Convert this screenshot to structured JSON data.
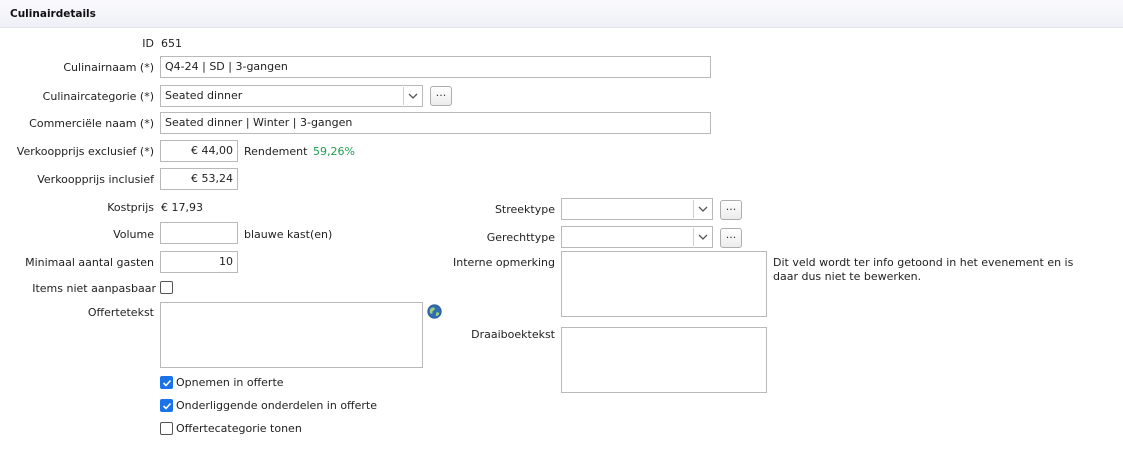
{
  "header": {
    "title": "Culinairdetails"
  },
  "fields": {
    "id": {
      "label": "ID",
      "value": "651"
    },
    "culinairnaam": {
      "label": "Culinairnaam (*)",
      "value": "Q4-24 | SD | 3-gangen"
    },
    "culinaircategorie": {
      "label": "Culinaircategorie (*)",
      "value": "Seated dinner",
      "more": "..."
    },
    "commerciele_naam": {
      "label": "Commerciële naam (*)",
      "value": "Seated dinner | Winter | 3-gangen"
    },
    "verkoopprijs_excl": {
      "label": "Verkoopprijs exclusief (*)",
      "value": "€ 44,00"
    },
    "rendement": {
      "label": "Rendement",
      "value": "59,26%"
    },
    "verkoopprijs_incl": {
      "label": "Verkoopprijs inclusief",
      "value": "€ 53,24"
    },
    "kostprijs": {
      "label": "Kostprijs",
      "value": "€ 17,93"
    },
    "volume": {
      "label": "Volume",
      "value": "",
      "unit": "blauwe kast(en)"
    },
    "min_gasten": {
      "label": "Minimaal aantal gasten",
      "value": "10"
    },
    "items_niet_aanpasbaar": {
      "label": "Items niet aanpasbaar",
      "checked": false
    },
    "offertetekst": {
      "label": "Offertetekst",
      "value": ""
    },
    "streektype": {
      "label": "Streektype",
      "value": "",
      "more": "..."
    },
    "gerechttype": {
      "label": "Gerechttype",
      "value": "",
      "more": "..."
    },
    "interne_opmerking": {
      "label": "Interne opmerking",
      "value": "",
      "note_line1": "Dit veld wordt ter info getoond in het evenement en is",
      "note_line2": "daar dus niet te bewerken."
    },
    "draaiboektekst": {
      "label": "Draaiboektekst",
      "value": ""
    }
  },
  "checkboxes": {
    "opnemen": {
      "label": "Opnemen in offerte",
      "checked": true
    },
    "onderliggende": {
      "label": "Onderliggende onderdelen in offerte",
      "checked": true
    },
    "categorie_tonen": {
      "label": "Offertecategorie tonen",
      "checked": false
    }
  },
  "colors": {
    "accent": "#1a73e8",
    "rendement": "#1e9e4e",
    "header_bg": "#eff0f6"
  },
  "icons": {
    "globe": "globe-icon",
    "dropdown": "chevron-down-icon",
    "check": "check-icon"
  }
}
